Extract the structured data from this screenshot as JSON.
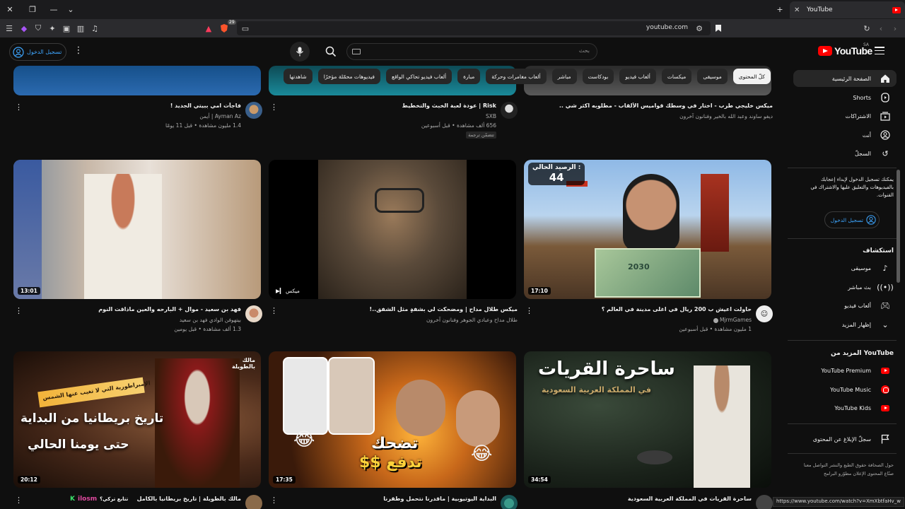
{
  "browser": {
    "tab_title": "YouTube",
    "url": "youtube.com",
    "badge_count": "29",
    "status_url": "https://www.youtube.com/watch?v=XmXbtfaHv_w"
  },
  "header": {
    "logo_text": "YouTube",
    "country_code": "SA",
    "search_placeholder": "بحث",
    "sign_in_label": "تسجيل الدخول"
  },
  "chips": [
    {
      "label": "كلّ المحتوى",
      "active": true
    },
    {
      "label": "موسيقى"
    },
    {
      "label": "ميكسات"
    },
    {
      "label": "ألعاب فيديو"
    },
    {
      "label": "بودكاست"
    },
    {
      "label": "مباشر"
    },
    {
      "label": "ألعاب مغامرات وحركة"
    },
    {
      "label": "مبارة"
    },
    {
      "label": "ألعاب فيديو تحاكي الواقع"
    },
    {
      "label": "فيديوهات محمّلة مؤخرًا"
    },
    {
      "label": "شاهدتها"
    }
  ],
  "sidebar": {
    "main": [
      {
        "label": "الصفحة الرئيسية",
        "icon": "home-icon"
      },
      {
        "label": "Shorts",
        "icon": "shorts-icon"
      },
      {
        "label": "الاشتراكات",
        "icon": "subscriptions-icon"
      },
      {
        "label": "أنت",
        "icon": "user-icon"
      },
      {
        "label": "السجلّ",
        "icon": "history-icon"
      }
    ],
    "signin_note": "يمكنك تسجيل الدخول لإبداء إعجابك بالفيديوهات والتعليق عليها والاشتراك في القنوات.",
    "signin_label": "تسجيل الدخول",
    "explore_title": "استكشاف",
    "explore": [
      {
        "label": "موسيقى",
        "icon": "music-note-icon"
      },
      {
        "label": "بث مباشر",
        "icon": "live-icon"
      },
      {
        "label": "ألعاب فيديو",
        "icon": "gaming-icon"
      },
      {
        "label": "إظهار المزيد",
        "icon": "chevron-down-icon"
      }
    ],
    "more_title": "المزيد من YouTube",
    "more": [
      {
        "label": "YouTube Premium"
      },
      {
        "label": "YouTube Music"
      },
      {
        "label": "YouTube Kids"
      }
    ],
    "report_label": "سجلّ الإبلاغ عن المحتوى",
    "footer": "حول  الصحافة  حقوق الطبع والنشر  التواصل معنا  صنّاع المحتوى  الإعلان  مطوّرو البرامج"
  },
  "videos_row0": [
    {
      "title": "ميكس خليجي طرب - اختار في وسطك قواميس الألقاب - مطلوبه اكثر شي ..",
      "channel": "ميكس خليجي",
      "meta": "ديفو ساوند وعبد الله بالخير وفنانون آخرون"
    },
    {
      "title": "Risk | عودة لعبة الخبث والتخطيط",
      "channel": "SXB",
      "meta": "656 ألف مشاهدة • قبل أسبوعين",
      "badge": "تتضمّن ترجمة"
    },
    {
      "title": "فاجأت امي ببيتي الجديد !",
      "channel": "Ayman Az | أيمن",
      "meta": "1.4 مليون مشاهدة • قبل 11 يومًا"
    }
  ],
  "videos_row1": [
    {
      "title": "حاولت اعيش ب 200 ريال في اغلى مدينة في العالم ؟",
      "channel": "MjrmGames",
      "meta": "1 مليون مشاهدة • قبل أسبوعين",
      "duration": "17:10",
      "overlay_label": "الرصيد الحالي :",
      "overlay_value": "44",
      "note_value": "2030"
    },
    {
      "title": "ميكس طلال مداح | ومضحكت لي بشفةٍ مثل الشفق..!",
      "channel": "طلال مداح وعبادي الجوهر وفنانون آخرون",
      "meta": "",
      "duration": "ميكس"
    },
    {
      "title": "فهد بن سعيد - موال + البارحه والعين ماذاقت النوم",
      "channel": "بيتهوفن الوادي فهد بن سعيد",
      "meta": "1.3 ألف مشاهدة • قبل يومين",
      "duration": "13:01"
    }
  ],
  "videos_row2": [
    {
      "title": "ساحرة القريات في المملكة العربية السعودية",
      "duration": "34:54",
      "thumb_title": "ساحرة القريات",
      "thumb_sub": "في المملكة العربية السعودية"
    },
    {
      "title": "البداية اليوتيوبية | ماقدرنا نتحمل وطقرنا",
      "duration": "17:35",
      "thumb_line1": "تضحك",
      "thumb_line2": "تدفع $$"
    },
    {
      "title": "مالك بالطويلة | تاريخ بريطانيا بالكامل",
      "channel_tag": "ilosm",
      "duration": "20:12",
      "banner": "الإمبراطورية التي لا تغيب عنها الشمس",
      "thumb_line1": "تاريخ بريطانيا من البداية",
      "thumb_line2": "حتى يومنا الحالي",
      "logo_text": "مالك بالطويلة",
      "left_tag": "تتابع تركي؟"
    }
  ],
  "colors": {
    "accent": "#3ea6ff",
    "brand": "#ff0000",
    "bg": "#0f0f0f"
  }
}
